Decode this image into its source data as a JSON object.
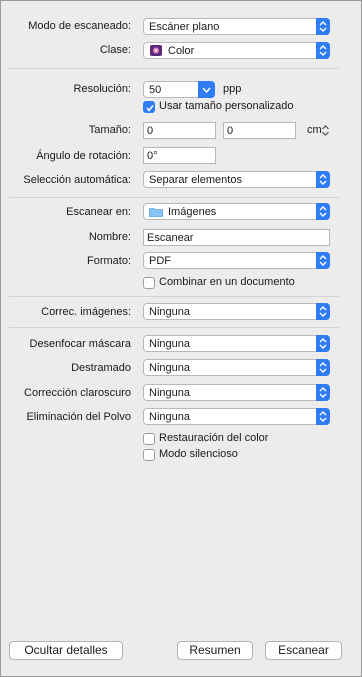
{
  "scan_mode": {
    "label": "Modo de escaneado:",
    "value": "Escáner plano"
  },
  "type": {
    "label": "Clase:",
    "value": "Color",
    "icon": "color-photo-icon"
  },
  "resolution": {
    "label": "Resolución:",
    "value": "50",
    "unit": "ppp"
  },
  "custom_size": {
    "label": "Usar tamaño personalizado",
    "checked": true
  },
  "size": {
    "label": "Tamaño:",
    "width": "0",
    "height": "0",
    "unit": "cm"
  },
  "rotation": {
    "label": "Ángulo de rotación:",
    "value": "0°"
  },
  "auto_selection": {
    "label": "Selección automática:",
    "value": "Separar elementos"
  },
  "scan_to": {
    "label": "Escanear en:",
    "value": "Imágenes",
    "icon": "folder-icon"
  },
  "name": {
    "label": "Nombre:",
    "value": "Escanear"
  },
  "format": {
    "label": "Formato:",
    "value": "PDF"
  },
  "combine": {
    "label": "Combinar en un documento",
    "checked": false
  },
  "image_correction": {
    "label": "Correc. imágenes:",
    "value": "Ninguna"
  },
  "unsharp_mask": {
    "label": "Desenfocar máscara",
    "value": "Ninguna"
  },
  "descreening": {
    "label": "Destramado",
    "value": "Ninguna"
  },
  "backlight_correction": {
    "label": "Corrección claroscuro",
    "value": "Ninguna"
  },
  "dust_removal": {
    "label": "Eliminación del Polvo",
    "value": "Ninguna"
  },
  "color_restoration": {
    "label": "Restauración del color",
    "checked": false
  },
  "quiet_mode": {
    "label": "Modo silencioso",
    "checked": false
  },
  "buttons": {
    "hide_details": "Ocultar detalles",
    "overview": "Resumen",
    "scan": "Escanear"
  },
  "colors": {
    "accent": "#2e7cf6",
    "panel_bg": "#ececec"
  }
}
